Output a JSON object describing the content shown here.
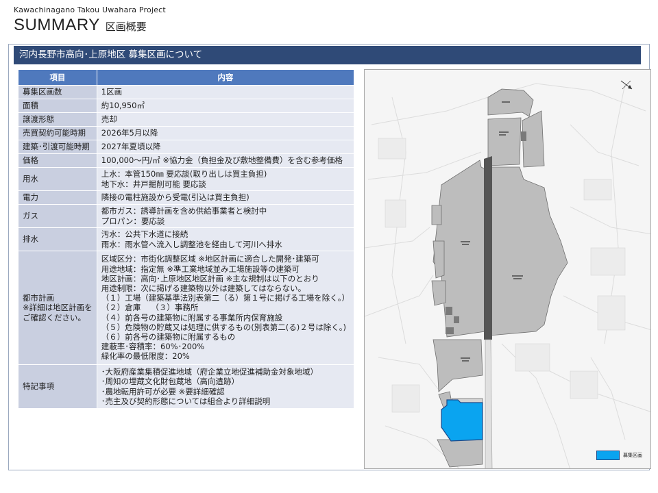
{
  "header": {
    "project": "Kawachinagano Takou Uwahara  Project",
    "title_en": "SUMMARY",
    "title_ja": "区画概要"
  },
  "section": {
    "title": "河内長野市高向･上原地区  募集区画について"
  },
  "table": {
    "headers": [
      "項目",
      "内容"
    ],
    "rows": [
      {
        "label": [
          "募集区画数"
        ],
        "value": [
          "1区画"
        ]
      },
      {
        "label": [
          "面積"
        ],
        "value": [
          "約10,950㎡"
        ]
      },
      {
        "label": [
          "譲渡形態"
        ],
        "value": [
          "売却"
        ]
      },
      {
        "label": [
          "売買契約可能時期"
        ],
        "value": [
          "2026年5月以降"
        ]
      },
      {
        "label": [
          "建築･引渡可能時期"
        ],
        "value": [
          "2027年夏頃以降"
        ]
      },
      {
        "label": [
          "価格"
        ],
        "value": [
          "100,000～円/㎡ ※協力金（負担金及び敷地整備費）を含む参考価格"
        ]
      },
      {
        "label": [
          "用水"
        ],
        "value": [
          "上水：本管150㎜  要応談(取り出しは買主負担)",
          "地下水：井戸掘削可能 要応談"
        ]
      },
      {
        "label": [
          "電力"
        ],
        "value": [
          "隣接の電柱施設から受電(引込は買主負担)"
        ]
      },
      {
        "label": [
          "ガス"
        ],
        "value": [
          "都市ガス：誘導計画を含め供給事業者と検討中",
          "プロパン：要応談"
        ]
      },
      {
        "label": [
          "排水"
        ],
        "value": [
          "汚水：公共下水道に接続",
          "雨水：雨水管へ流入し調整池を経由して河川へ排水"
        ]
      },
      {
        "label": [
          "都市計画",
          "※詳細は地区計画を",
          "ご確認ください。"
        ],
        "value": [
          "区域区分：市街化調整区域  ※地区計画に適合した開発･建築可",
          "用途地域：指定無  ※準工業地域並み工場施設等の建築可",
          "地区計画：高向･上原地区地区計画  ※主な規制は以下のとおり",
          "用途制限：次に掲げる建築物以外は建築してはならない。",
          "（１）工場（建築基準法別表第二（る）第１号に掲げる工場を除く。）",
          "（２）倉庫　 （３）事務所",
          "（４）前各号の建築物に附属する事業所内保育施設",
          "（５）危険物の貯蔵又は処理に供するもの(別表第二(る)２号は除く。)",
          "（６）前各号の建築物に附属するもの",
          "建蔽率･容積率：60%･200%",
          "緑化率の最低限度：20%"
        ]
      },
      {
        "label": [
          "特記事項"
        ],
        "value": [
          "･大阪府産業集積促進地域（府企業立地促進補助金対象地域）",
          "･周知の埋蔵文化財包蔵地（高向遺跡）",
          "･農地転用許可が必要 ※要詳細確認",
          "･売主及び契約形態については組合より詳細説明"
        ]
      }
    ]
  },
  "map": {
    "legend_label": "募集区画",
    "colors": {
      "site": "#0aa4f0",
      "site_border": "#1d4a8a",
      "gray_block": "#bdbdbd",
      "dark_road": "#555555",
      "background": "#f6f6f6"
    },
    "icons": [
      "north-arrow-icon"
    ]
  }
}
